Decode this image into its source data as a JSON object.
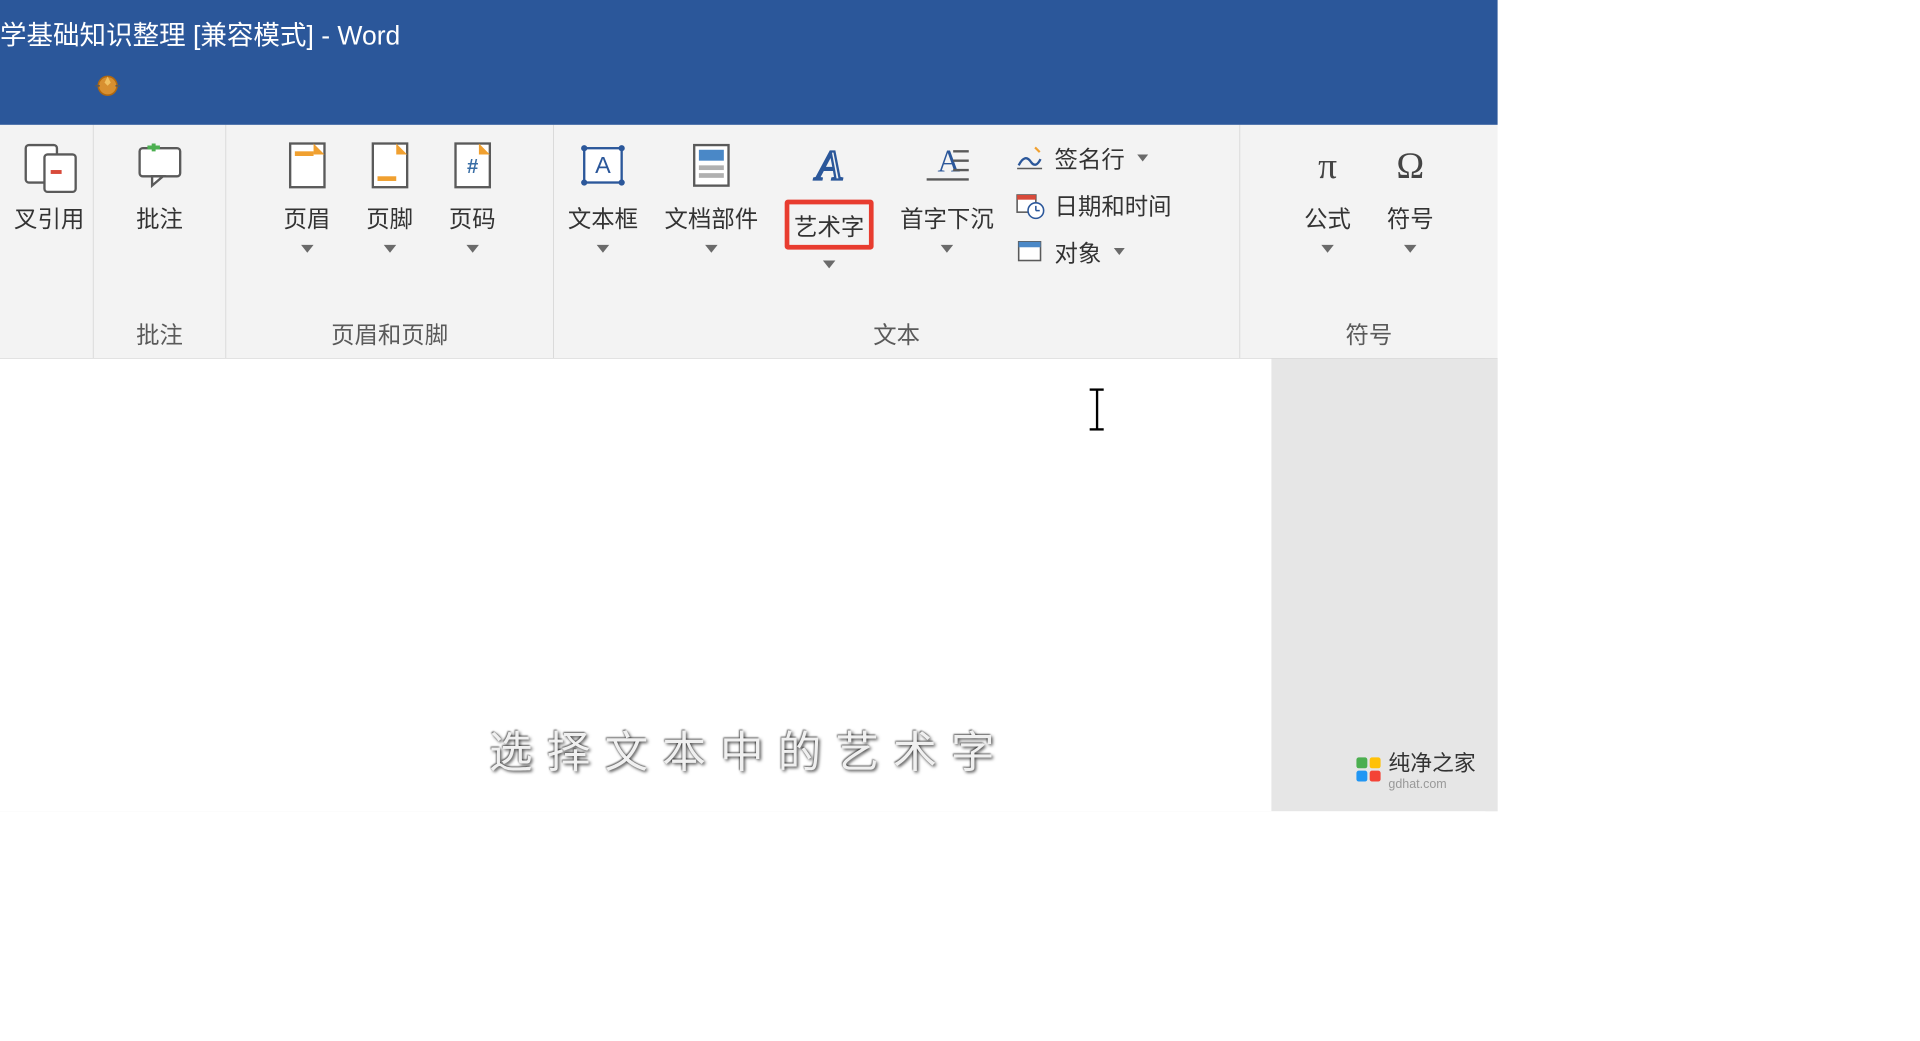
{
  "title": {
    "document_name": "学基础知识整理 [兼容模式]",
    "separator": " - ",
    "app_name": "Word"
  },
  "ribbon": {
    "groups": {
      "reference": {
        "button_cross_reference": "叉引用"
      },
      "comments": {
        "label": "批注",
        "button_comment": "批注"
      },
      "header_footer": {
        "label": "页眉和页脚",
        "button_header": "页眉",
        "button_footer": "页脚",
        "button_page_number": "页码"
      },
      "text": {
        "label": "文本",
        "button_text_box": "文本框",
        "button_quick_parts": "文档部件",
        "button_word_art": "艺术字",
        "button_drop_cap": "首字下沉",
        "button_signature_line": "签名行",
        "button_date_time": "日期和时间",
        "button_object": "对象"
      },
      "symbols": {
        "label": "符号",
        "button_equation": "公式",
        "button_symbol": "符号"
      }
    }
  },
  "subtitle_text": "选择文本中的艺术字",
  "watermark": {
    "name": "纯净之家",
    "url": "gdhat.com"
  },
  "colors": {
    "title_bar": "#2b579a",
    "ribbon_bg": "#f3f3f3",
    "highlight": "#e83c2f",
    "accent_blue": "#2b579a",
    "accent_orange": "#f0a030"
  }
}
